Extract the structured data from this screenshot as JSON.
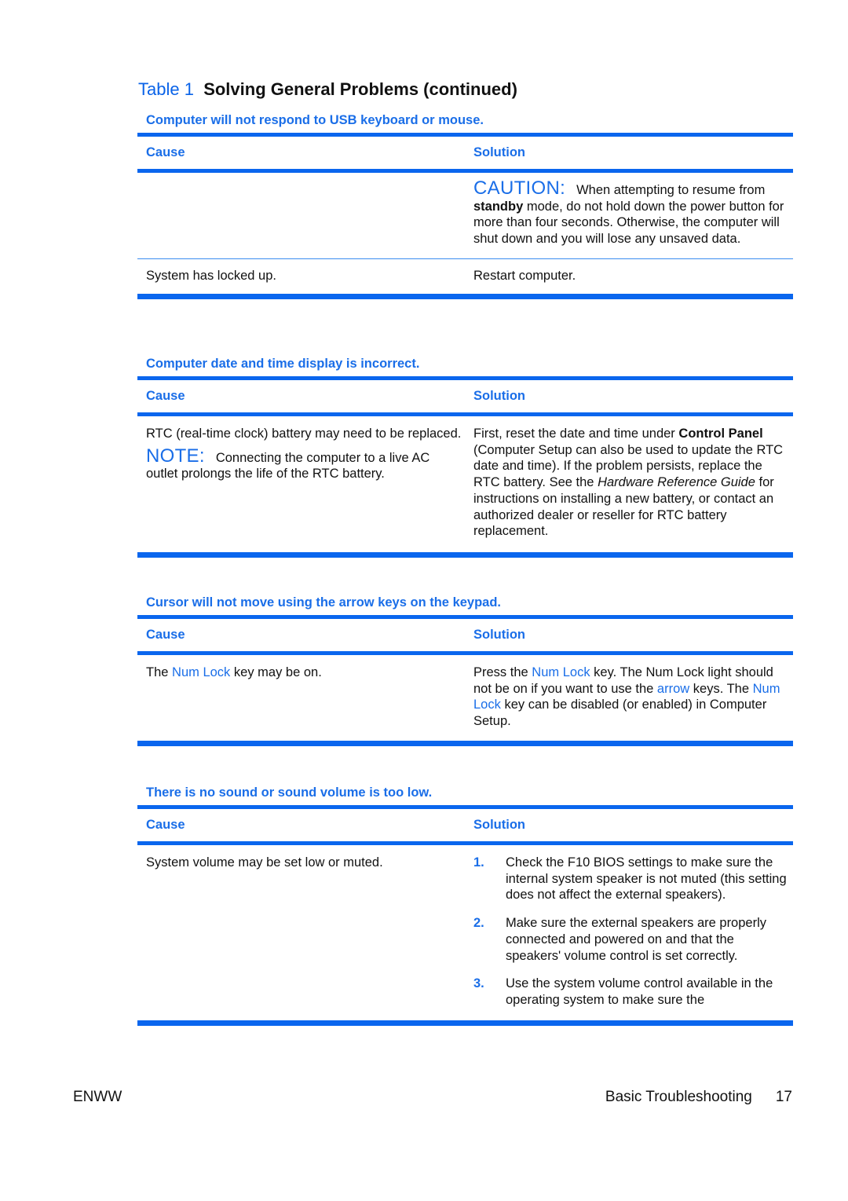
{
  "title": {
    "label": "Table 1",
    "text": "Solving General Problems (continued)"
  },
  "sections": [
    {
      "title": "Computer will not respond to USB keyboard or mouse.",
      "headers": {
        "cause": "Cause",
        "solution": "Solution"
      },
      "caution": {
        "label": "CAUTION:",
        "text_1": "When attempting to resume from",
        "bold": "standby",
        "text_2": "mode, do not hold down the power button for more than four seconds. Otherwise, the computer will shut down and you will lose any unsaved data."
      },
      "row": {
        "cause": "System has locked up.",
        "solution": "Restart computer."
      }
    },
    {
      "title": "Computer date and time display is incorrect.",
      "headers": {
        "cause": "Cause",
        "solution": "Solution"
      },
      "cause": "RTC (real-time clock) battery may need to be replaced.",
      "note": {
        "label": "NOTE:",
        "text": "Connecting the computer to a live AC outlet prolongs the life of the RTC battery."
      },
      "solution": {
        "text_1": "First, reset the date and time under",
        "bold": "Control Panel",
        "text_2": "(Computer Setup can also be used to update the RTC date and time). If the problem persists, replace the RTC battery. See the",
        "italic": "Hardware Reference Guide",
        "text_3": "for instructions on installing a new battery, or contact an authorized dealer or reseller for RTC battery replacement."
      }
    },
    {
      "title": "Cursor will not move using the arrow keys on the keypad.",
      "headers": {
        "cause": "Cause",
        "solution": "Solution"
      },
      "cause": {
        "text_1": "The",
        "link": "Num Lock",
        "text_2": "key may be on."
      },
      "solution": {
        "text_1": "Press the",
        "link_1": "Num Lock",
        "text_2": "key. The Num Lock light should not be on if you want to use the",
        "link_2": "arrow",
        "text_3": "keys. The",
        "link_3": "Num Lock",
        "text_4": "key can be disabled (or enabled) in Computer Setup."
      }
    },
    {
      "title": "There is no sound or sound volume is too low.",
      "headers": {
        "cause": "Cause",
        "solution": "Solution"
      },
      "cause": "System volume may be set low or muted.",
      "steps": [
        {
          "num": "1.",
          "text": "Check the F10 BIOS settings to make sure the internal system speaker is not muted (this setting does not affect the external speakers)."
        },
        {
          "num": "2.",
          "text": "Make sure the external speakers are properly connected and powered on and that the speakers' volume control is set correctly."
        },
        {
          "num": "3.",
          "text": "Use the system volume control available in the operating system to make sure the"
        }
      ]
    }
  ],
  "footer": {
    "left": "ENWW",
    "section": "Basic Troubleshooting",
    "page": "17"
  }
}
